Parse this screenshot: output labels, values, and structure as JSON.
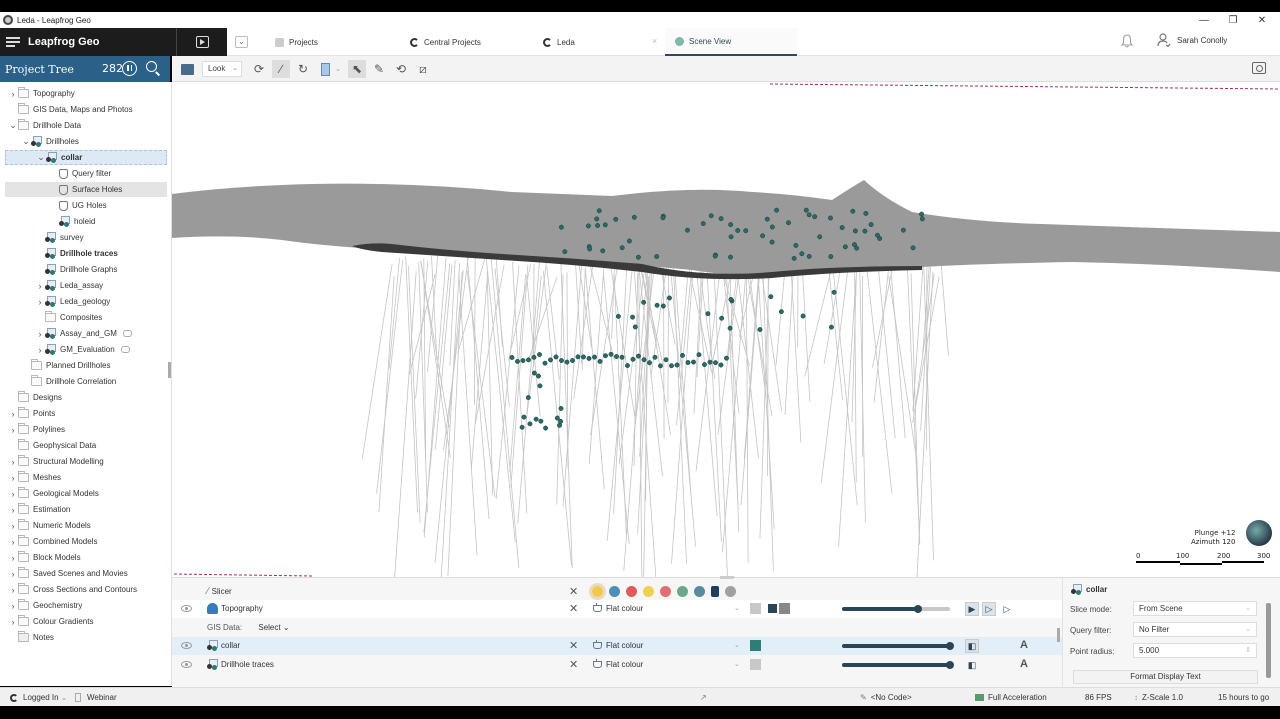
{
  "window": {
    "title": "Leda - Leapfrog Geo",
    "controls": {
      "minimize": "—",
      "maximize": "❐",
      "close": "✕"
    }
  },
  "app": {
    "name": "Leapfrog Geo"
  },
  "tabs": [
    {
      "label": "Projects",
      "icon": "projects-icon",
      "active": false
    },
    {
      "label": "Central Projects",
      "icon": "central-icon",
      "active": false
    },
    {
      "label": "Leda",
      "icon": "central-icon",
      "active": false
    },
    {
      "label": "Scene View",
      "icon": "scene-icon",
      "active": true
    }
  ],
  "tab_dropdown": "⌄",
  "tab_close": "×",
  "user": {
    "name": "Sarah Conolly"
  },
  "project_tree": {
    "title": "Project Tree",
    "count": "282",
    "items": [
      {
        "label": "Topography",
        "level": 0,
        "expander": "›",
        "icon": "folder",
        "state": ""
      },
      {
        "label": "GIS Data, Maps and Photos",
        "level": 0,
        "expander": "",
        "icon": "folder",
        "state": ""
      },
      {
        "label": "Drillhole Data",
        "level": 0,
        "expander": "⌄",
        "icon": "folder",
        "state": ""
      },
      {
        "label": "Drillholes",
        "level": 1,
        "expander": "⌄",
        "icon": "drillhole",
        "state": ""
      },
      {
        "label": "collar",
        "level": 2,
        "expander": "⌄",
        "icon": "drillhole",
        "state": "selected",
        "bold": true
      },
      {
        "label": "Query filter",
        "level": 3,
        "expander": "",
        "icon": "filter",
        "state": ""
      },
      {
        "label": "Surface Holes",
        "level": 3,
        "expander": "",
        "icon": "filter",
        "state": "hover"
      },
      {
        "label": "UG Holes",
        "level": 3,
        "expander": "",
        "icon": "filter",
        "state": ""
      },
      {
        "label": "holeid",
        "level": 3,
        "expander": "",
        "icon": "drillhole",
        "state": ""
      },
      {
        "label": "survey",
        "level": 2,
        "expander": "",
        "icon": "drillhole",
        "state": ""
      },
      {
        "label": "Drillhole traces",
        "level": 2,
        "expander": "",
        "icon": "drillhole",
        "state": "",
        "bold": true
      },
      {
        "label": "Drillhole Graphs",
        "level": 2,
        "expander": "",
        "icon": "drillhole",
        "state": ""
      },
      {
        "label": "Leda_assay",
        "level": 2,
        "expander": "›",
        "icon": "drillhole",
        "state": ""
      },
      {
        "label": "Leda_geology",
        "level": 2,
        "expander": "›",
        "icon": "drillhole",
        "state": ""
      },
      {
        "label": "Composites",
        "level": 2,
        "expander": "",
        "icon": "folder",
        "state": ""
      },
      {
        "label": "Assay_and_GM",
        "level": 2,
        "expander": "›",
        "icon": "drillhole",
        "state": "",
        "note": true
      },
      {
        "label": "GM_Evaluation",
        "level": 2,
        "expander": "›",
        "icon": "drillhole",
        "state": "",
        "note": true
      },
      {
        "label": "Planned Drillholes",
        "level": 1,
        "expander": "",
        "icon": "folder",
        "state": ""
      },
      {
        "label": "Drillhole Correlation",
        "level": 1,
        "expander": "",
        "icon": "folder",
        "state": ""
      },
      {
        "label": "Designs",
        "level": 0,
        "expander": "",
        "icon": "folder",
        "state": ""
      },
      {
        "label": "Points",
        "level": 0,
        "expander": "›",
        "icon": "folder",
        "state": ""
      },
      {
        "label": "Polylines",
        "level": 0,
        "expander": "›",
        "icon": "folder",
        "state": ""
      },
      {
        "label": "Geophysical Data",
        "level": 0,
        "expander": "",
        "icon": "folder",
        "state": ""
      },
      {
        "label": "Structural Modelling",
        "level": 0,
        "expander": "›",
        "icon": "folder",
        "state": ""
      },
      {
        "label": "Meshes",
        "level": 0,
        "expander": "›",
        "icon": "folder",
        "state": ""
      },
      {
        "label": "Geological Models",
        "level": 0,
        "expander": "›",
        "icon": "folder",
        "state": ""
      },
      {
        "label": "Estimation",
        "level": 0,
        "expander": "›",
        "icon": "folder",
        "state": ""
      },
      {
        "label": "Numeric Models",
        "level": 0,
        "expander": "›",
        "icon": "folder",
        "state": ""
      },
      {
        "label": "Combined Models",
        "level": 0,
        "expander": "›",
        "icon": "folder",
        "state": ""
      },
      {
        "label": "Block Models",
        "level": 0,
        "expander": "›",
        "icon": "folder",
        "state": ""
      },
      {
        "label": "Saved Scenes and Movies",
        "level": 0,
        "expander": "›",
        "icon": "folder",
        "state": ""
      },
      {
        "label": "Cross Sections and Contours",
        "level": 0,
        "expander": "›",
        "icon": "folder",
        "state": ""
      },
      {
        "label": "Geochemistry",
        "level": 0,
        "expander": "›",
        "icon": "folder",
        "state": ""
      },
      {
        "label": "Colour Gradients",
        "level": 0,
        "expander": "›",
        "icon": "folder",
        "state": ""
      },
      {
        "label": "Notes",
        "level": 0,
        "expander": "",
        "icon": "note",
        "state": ""
      }
    ]
  },
  "toolbar": {
    "look_label": "Look",
    "tools": [
      "scene-settings-icon",
      "rotate-icon",
      "slicer-icon",
      "refresh-icon",
      "view-panel-icon",
      "select-icon",
      "draw-icon",
      "cycle-icon",
      "ruler-icon"
    ]
  },
  "scene": {
    "plunge": "Plunge +12",
    "azimuth": "Azimuth 120",
    "scale_ticks": [
      "0",
      "100",
      "200",
      "300"
    ]
  },
  "shown_objects": {
    "slicer_label": "Slicer",
    "layers": [
      {
        "name": "Topography",
        "mode": "Flat colour",
        "color": "#c8c8c8",
        "opacity": 0.7,
        "highlight": "white"
      },
      {
        "name": "collar",
        "mode": "Flat colour",
        "color": "#2e7d7a",
        "opacity": 1.0,
        "highlight": "blue"
      },
      {
        "name": "Drillhole traces",
        "mode": "Flat colour",
        "color": "#c8c8c8",
        "opacity": 1.0,
        "highlight": "none"
      }
    ],
    "gis_label": "GIS Data:",
    "gis_select": "Select",
    "label_glyph": "A",
    "colors": [
      "#f2c94c",
      "#4a90b8",
      "#e05a5a",
      "#f0d050",
      "#e07070",
      "#6aa88a",
      "#5a8aa0",
      "#1f3f5f",
      "#a0a0a0"
    ]
  },
  "properties": {
    "object": "collar",
    "slice_mode_label": "Slice mode:",
    "slice_mode_value": "From Scene",
    "query_filter_label": "Query filter:",
    "query_filter_value": "No Filter",
    "point_radius_label": "Point radius:",
    "point_radius_value": "5.000",
    "format_button": "Format Display Text"
  },
  "statusbar": {
    "login": "Logged In",
    "webinar": "Webinar",
    "code": "<No Code>",
    "acceleration": "Full Acceleration",
    "fps": "86 FPS",
    "zscale": "Z-Scale 1.0",
    "time": "15 hours to go"
  }
}
